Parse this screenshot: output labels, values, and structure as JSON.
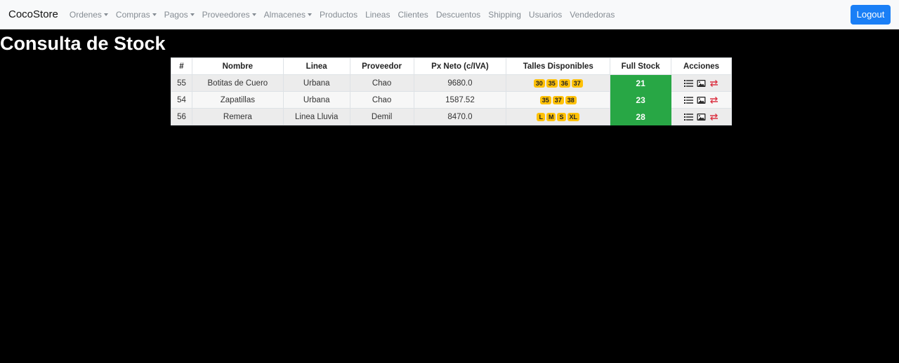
{
  "navbar": {
    "brand": "CocoStore",
    "items": [
      {
        "label": "Ordenes",
        "dropdown": true
      },
      {
        "label": "Compras",
        "dropdown": true
      },
      {
        "label": "Pagos",
        "dropdown": true
      },
      {
        "label": "Proveedores",
        "dropdown": true
      },
      {
        "label": "Almacenes",
        "dropdown": true
      },
      {
        "label": "Productos",
        "dropdown": false
      },
      {
        "label": "Lineas",
        "dropdown": false
      },
      {
        "label": "Clientes",
        "dropdown": false
      },
      {
        "label": "Descuentos",
        "dropdown": false
      },
      {
        "label": "Shipping",
        "dropdown": false
      },
      {
        "label": "Usuarios",
        "dropdown": false
      },
      {
        "label": "Vendedoras",
        "dropdown": false
      }
    ],
    "logout_label": "Logout"
  },
  "page": {
    "title": "Consulta de Stock"
  },
  "table": {
    "headers": [
      "#",
      "Nombre",
      "Linea",
      "Proveedor",
      "Px Neto (c/IVA)",
      "Talles Disponibles",
      "Full Stock",
      "Acciones"
    ],
    "rows": [
      {
        "id": "55",
        "nombre": "Botitas de Cuero",
        "linea": "Urbana",
        "proveedor": "Chao",
        "px_neto": "9680.0",
        "talles": [
          "30",
          "35",
          "36",
          "37"
        ],
        "full_stock": "21"
      },
      {
        "id": "54",
        "nombre": "Zapatillas",
        "linea": "Urbana",
        "proveedor": "Chao",
        "px_neto": "1587.52",
        "talles": [
          "35",
          "37",
          "38"
        ],
        "full_stock": "23"
      },
      {
        "id": "56",
        "nombre": "Remera",
        "linea": "Linea Lluvia",
        "proveedor": "Demil",
        "px_neto": "8470.0",
        "talles": [
          "L",
          "M",
          "S",
          "XL"
        ],
        "full_stock": "28"
      }
    ],
    "action_icons": [
      "list-icon",
      "image-icon",
      "transfer-icon"
    ]
  },
  "colors": {
    "navbar_bg": "#f8f9fa",
    "logout_bg": "#1a7ff6",
    "stock_bg": "#28a745",
    "badge_bg": "#ffc107",
    "transfer_icon": "#dc3545"
  }
}
